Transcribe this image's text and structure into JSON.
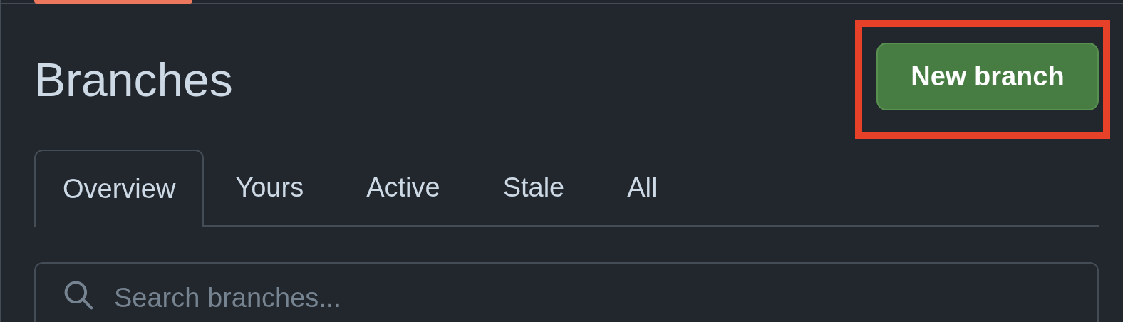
{
  "page": {
    "title": "Branches"
  },
  "new_branch_button": {
    "label": "New branch",
    "highlighted": true
  },
  "tabs": [
    {
      "label": "Overview",
      "selected": true
    },
    {
      "label": "Yours",
      "selected": false
    },
    {
      "label": "Active",
      "selected": false
    },
    {
      "label": "Stale",
      "selected": false
    },
    {
      "label": "All",
      "selected": false
    }
  ],
  "search": {
    "placeholder": "Search branches..."
  }
}
